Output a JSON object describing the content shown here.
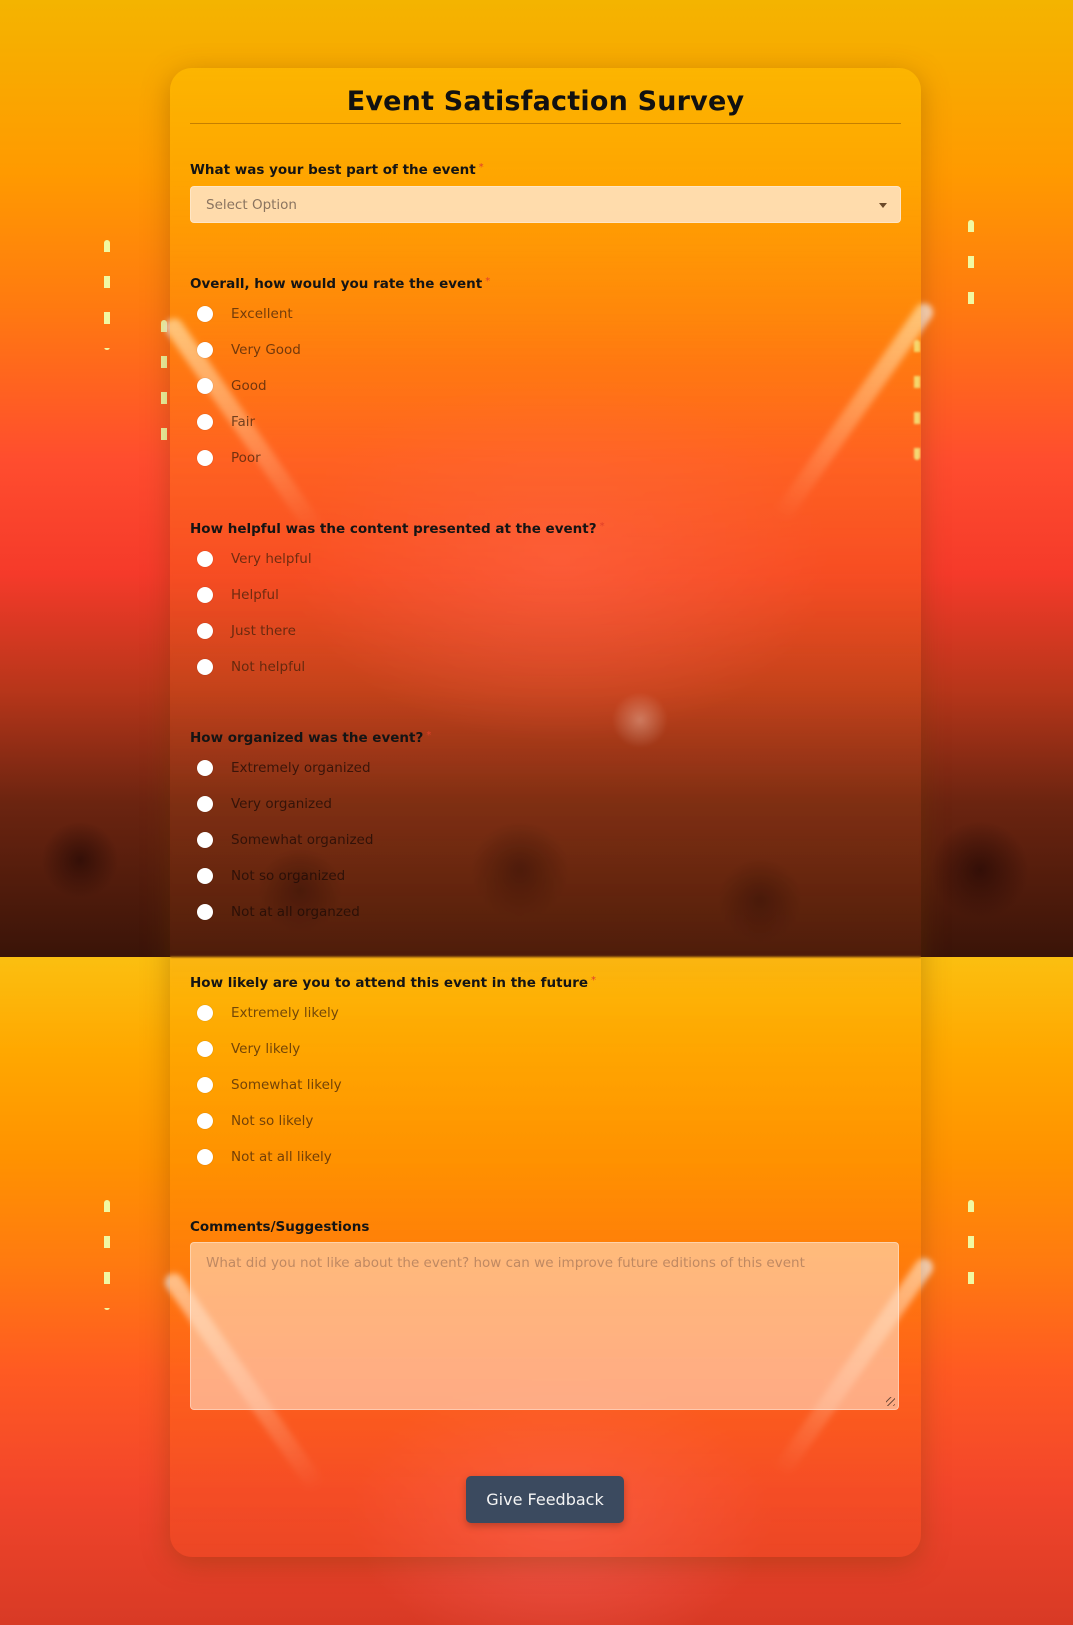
{
  "form": {
    "title": "Event Satisfaction Survey",
    "required_marker": "*",
    "q1": {
      "label": "What was your best part of the event",
      "required": true,
      "select": {
        "selected": "Select Option"
      }
    },
    "q2": {
      "label": "Overall, how would you rate the event",
      "required": true,
      "options": [
        "Excellent",
        "Very Good",
        "Good",
        "Fair",
        "Poor"
      ]
    },
    "q3": {
      "label": "How helpful was the content presented at the event?",
      "required": true,
      "options": [
        "Very helpful",
        "Helpful",
        "Just there",
        "Not helpful"
      ]
    },
    "q4": {
      "label": "How organized was the event?",
      "required": true,
      "options": [
        "Extremely organized",
        "Very organized",
        "Somewhat organized",
        "Not so organized",
        "Not at all organzed"
      ]
    },
    "q5": {
      "label": "How likely are you to attend this event in the future",
      "required": true,
      "options": [
        "Extremely likely",
        "Very likely",
        "Somewhat likely",
        "Not so likely",
        "Not at all likely"
      ]
    },
    "comments": {
      "label": "Comments/Suggestions",
      "placeholder": "What did you not like about the event? how can we improve future editions of this event",
      "value": ""
    },
    "submit_label": "Give Feedback"
  },
  "colors": {
    "button": "#3b4a5f",
    "required": "#e0402a",
    "title": "#111111"
  }
}
